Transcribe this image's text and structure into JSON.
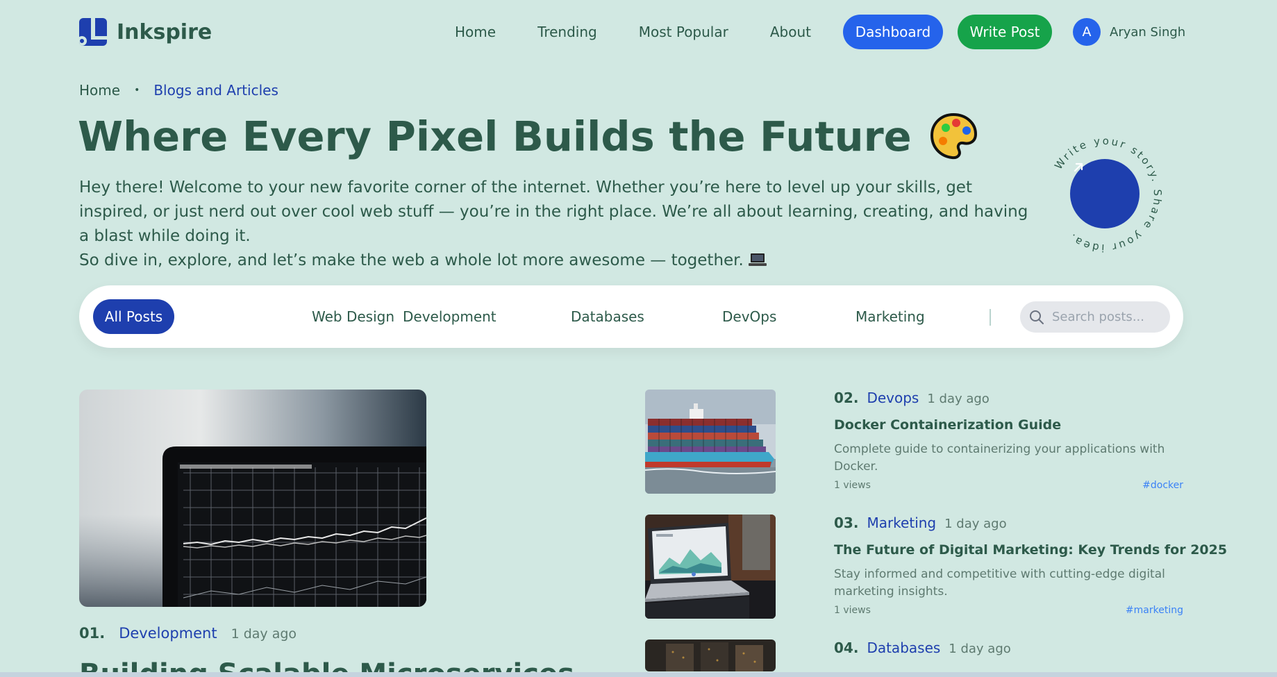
{
  "header": {
    "logo_text": "Inkspire",
    "nav": [
      "Home",
      "Trending",
      "Most Popular",
      "About"
    ],
    "dashboard_label": "Dashboard",
    "write_label": "Write Post",
    "avatar_initial": "A",
    "user_name": "Aryan Singh"
  },
  "breadcrumb": {
    "home": "Home",
    "separator": "•",
    "current": "Blogs and Articles"
  },
  "hero": {
    "title": "Where Every Pixel Builds the Future",
    "intro_line1": "Hey there! Welcome to your new favorite corner of the internet. Whether you’re here to level up your skills, get inspired, or just nerd out over cool web stuff — you’re in the right place. We’re all about learning, creating, and having a blast while doing it.",
    "intro_line2": "So dive in, explore, and let’s make the web a whole lot more awesome — together.",
    "circle_text": "Write your story. Share your idea."
  },
  "filters": {
    "chips": [
      "All Posts",
      "Web Design",
      "Development",
      "Databases",
      "DevOps",
      "Marketing"
    ],
    "search_placeholder": "Search posts..."
  },
  "featured": {
    "number": "01.",
    "category": "Development",
    "ago": "1 day ago",
    "title": "Building Scalable Microservices"
  },
  "posts": [
    {
      "number": "02.",
      "category": "Devops",
      "ago": "1 day ago",
      "title": "Docker Containerization Guide",
      "desc": "Complete guide to containerizing your applications with Docker.",
      "views": "1 views",
      "tag": "#docker"
    },
    {
      "number": "03.",
      "category": "Marketing",
      "ago": "1 day ago",
      "title": "The Future of Digital Marketing: Key Trends for 2025",
      "desc": "Stay informed and competitive with cutting-edge digital marketing insights.",
      "views": "1 views",
      "tag": "#marketing"
    },
    {
      "number": "04.",
      "category": "Databases",
      "ago": "1 day ago"
    }
  ],
  "colors": {
    "background": "#d1e8e2",
    "primary_blue": "#1e3fae",
    "dashboard_blue": "#2563eb",
    "write_green": "#16a34a",
    "text_green": "#2d5a4a"
  }
}
